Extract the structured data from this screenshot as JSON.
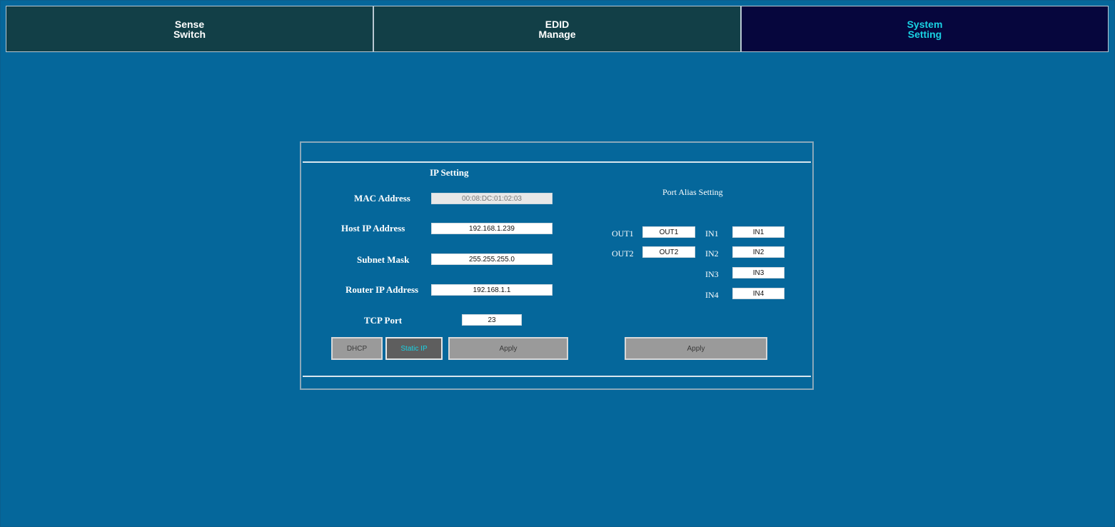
{
  "tabs": [
    {
      "label": "Sense\nSwitch"
    },
    {
      "label": "EDID\nManage"
    },
    {
      "label": "System\nSetting"
    }
  ],
  "ip_setting": {
    "title": "IP Setting",
    "mac_label": "MAC Address",
    "mac_value": "00:08:DC:01:02:03",
    "host_ip_label": "Host IP Address",
    "host_ip_value": "192.168.1.239",
    "subnet_label": "Subnet Mask",
    "subnet_value": "255.255.255.0",
    "router_label": "Router IP Address",
    "router_value": "192.168.1.1",
    "tcp_label": "TCP Port",
    "tcp_value": "23",
    "dhcp_button": "DHCP",
    "static_button": "Static IP",
    "apply_button": "Apply"
  },
  "port_alias": {
    "title": "Port Alias Setting",
    "out1_label": "OUT1",
    "out1_value": "OUT1",
    "out2_label": "OUT2",
    "out2_value": "OUT2",
    "in1_label": "IN1",
    "in1_value": "IN1",
    "in2_label": "IN2",
    "in2_value": "IN2",
    "in3_label": "IN3",
    "in3_value": "IN3",
    "in4_label": "IN4",
    "in4_value": "IN4",
    "apply_button": "Apply"
  },
  "colors": {
    "background": "#05679b",
    "tab": "#123f47",
    "tab_active": "#06063d",
    "accent": "#19d1e3"
  }
}
